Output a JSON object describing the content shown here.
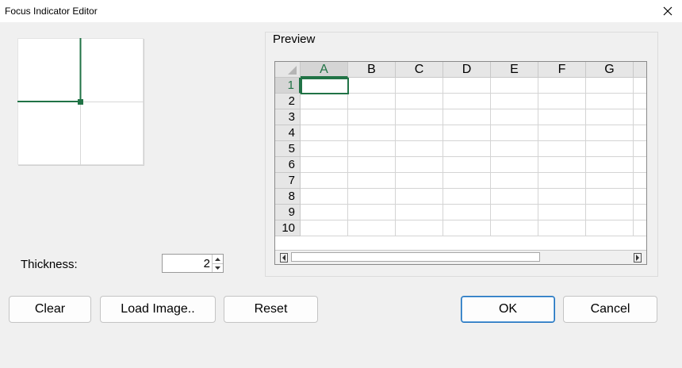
{
  "window": {
    "title": "Focus Indicator Editor",
    "close_icon": "close-icon"
  },
  "editor": {
    "line_color": "#217346"
  },
  "thickness": {
    "label": "Thickness:",
    "value": "2"
  },
  "preview": {
    "label": "Preview",
    "columns": [
      "A",
      "B",
      "C",
      "D",
      "E",
      "F",
      "G"
    ],
    "rows": [
      "1",
      "2",
      "3",
      "4",
      "5",
      "6",
      "7",
      "8",
      "9",
      "10"
    ],
    "active_cell": "A1",
    "accent_color": "#217346"
  },
  "buttons": {
    "clear": "Clear",
    "load_image": "Load Image..",
    "reset": "Reset",
    "ok": "OK",
    "cancel": "Cancel"
  }
}
